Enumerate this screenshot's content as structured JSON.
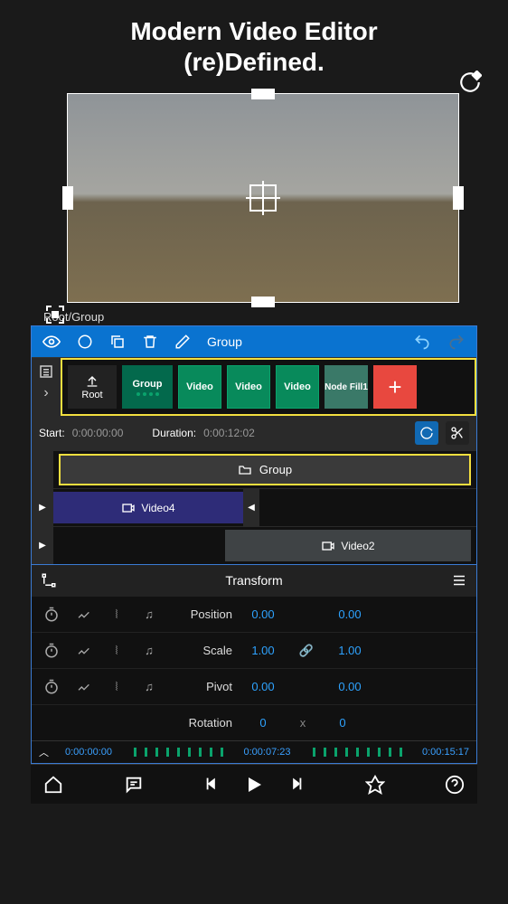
{
  "hero": {
    "line1": "Modern Video Editor",
    "line2": "(re)Defined."
  },
  "breadcrumb": "Root/Group",
  "toolbar": {
    "group_label": "Group"
  },
  "layers": {
    "root": "Root",
    "group": "Group",
    "video": "Video",
    "node": "Node Fill1",
    "add": "+"
  },
  "time_info": {
    "start_label": "Start:",
    "start_value": "0:00:00:00",
    "duration_label": "Duration:",
    "duration_value": "0:00:12:02"
  },
  "clips": {
    "group": "Group",
    "video4": "Video4",
    "video2": "Video2"
  },
  "transform": {
    "title": "Transform",
    "rows": [
      {
        "label": "Position",
        "a": "0.00",
        "b": "0.00"
      },
      {
        "label": "Scale",
        "a": "1.00",
        "b": "1.00",
        "link": true
      },
      {
        "label": "Pivot",
        "a": "0.00",
        "b": "0.00"
      },
      {
        "label": "Rotation",
        "a": "0",
        "mid": "x",
        "b": "0"
      }
    ]
  },
  "ruler": {
    "t0": "0:00:00:00",
    "t1": "0:00:07:23",
    "t2": "0:00:15:17"
  }
}
